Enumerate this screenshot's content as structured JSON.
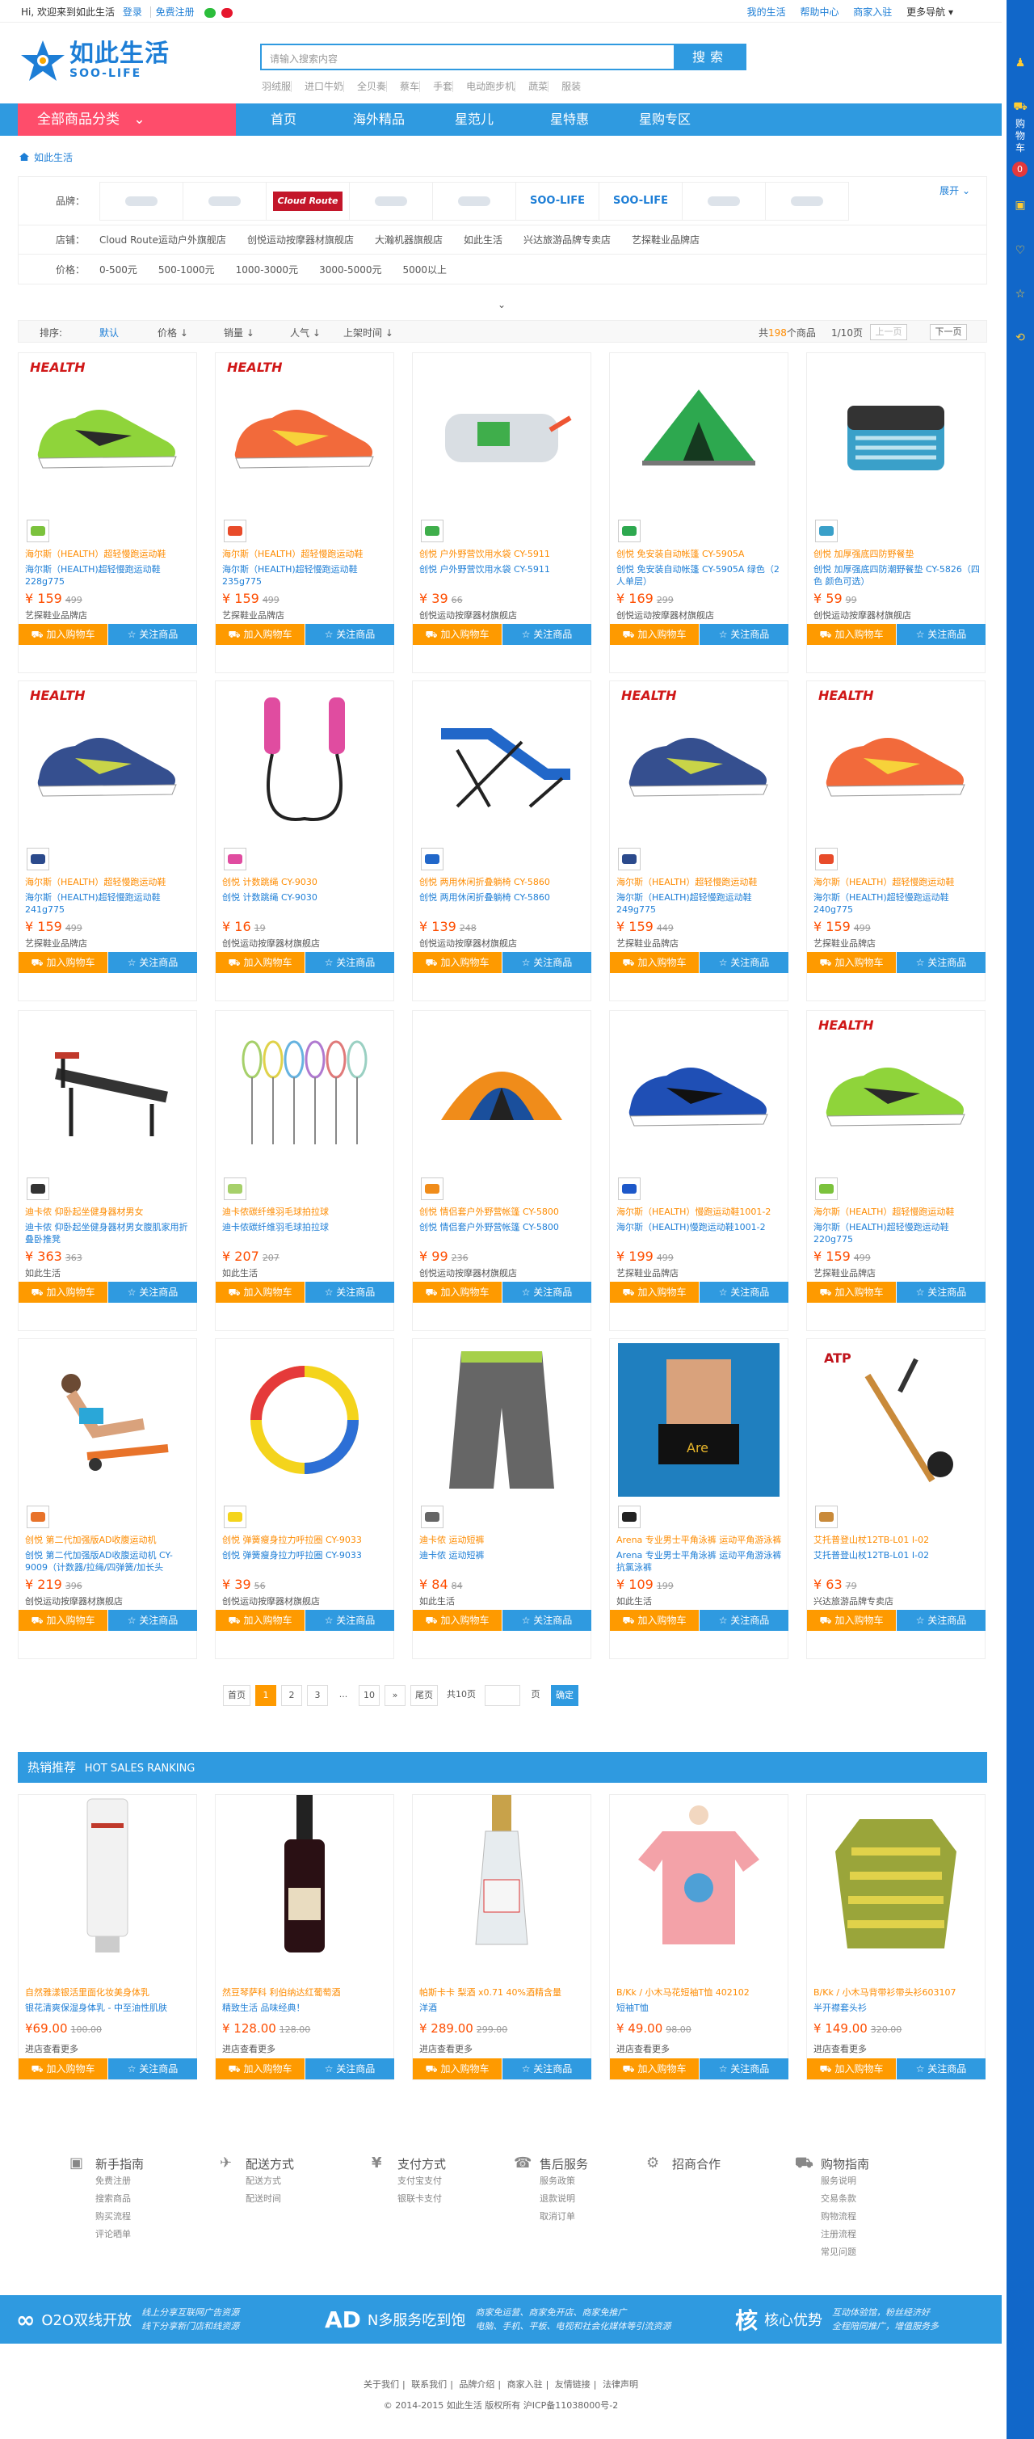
{
  "topbar": {
    "welcome": "Hi, 欢迎来到如此生活",
    "login": "登录",
    "register": "免费注册",
    "right": [
      "我的生活",
      "帮助中心",
      "商家入驻",
      "更多导航"
    ]
  },
  "logo": {
    "cn": "如此生活",
    "en": "SOO-LIFE"
  },
  "search": {
    "placeholder": "请输入搜索内容",
    "button": "搜索",
    "hotwords": [
      "羽绒服",
      "进口牛奶",
      "全贝奏",
      "蔡车",
      "手套",
      "电动跑步机",
      "蔬菜",
      "服装"
    ]
  },
  "nav": {
    "all": "全部商品分类",
    "items": [
      "首页",
      "海外精品",
      "星范儿",
      "星特惠",
      "星购专区"
    ]
  },
  "sidebar": {
    "cart": "购物车",
    "count": "0",
    "icons": [
      "cart-icon",
      "user-icon",
      "coupon-icon",
      "heart-icon",
      "star-icon",
      "refresh-icon"
    ]
  },
  "breadcrumb": "如此生活",
  "filter": {
    "brand_label": "品牌：",
    "expand": "展开",
    "brands": [
      "",
      "",
      "Cloud Route",
      "",
      "",
      "SOO-LIFE",
      "SOO-LIFE",
      "",
      ""
    ],
    "shop_label": "店铺：",
    "shops": [
      "Cloud Route运动户外旗舰店",
      "创悦运动按摩器材旗舰店",
      "大瀚机器旗舰店",
      "如此生活",
      "兴达旅游品牌专卖店",
      "艺探鞋业品牌店"
    ],
    "price_label": "价格：",
    "prices": [
      "0-500元",
      "500-1000元",
      "1000-3000元",
      "3000-5000元",
      "5000以上"
    ]
  },
  "sort": {
    "label": "排序:",
    "items": [
      "默认",
      "价格",
      "销量",
      "人气",
      "上架时间"
    ],
    "total_prefix": "共",
    "total": "198",
    "total_suffix": "个商品",
    "page": "1/10页",
    "prev": "上一页",
    "next": "下一页"
  },
  "products": [
    {
      "name": "海尔斯（HEALTH）超轻慢跑运动鞋",
      "desc": "海尔斯（HEALTH)超轻慢跑运动鞋228g775",
      "price": "¥ 159",
      "old": "499",
      "shop": "艺探鞋业品牌店",
      "color": "#7bc23c",
      "type": "shoe-green"
    },
    {
      "name": "海尔斯（HEALTH）超轻慢跑运动鞋",
      "desc": "海尔斯（HEALTH)超轻慢跑运动鞋235g775",
      "price": "¥ 159",
      "old": "499",
      "shop": "艺探鞋业品牌店",
      "color": "#e84b2a",
      "type": "shoe-red"
    },
    {
      "name": "创悦 户外野营饮用水袋 CY-5911",
      "desc": "创悦 户外野营饮用水袋 CY-5911",
      "price": "¥ 39",
      "old": "66",
      "shop": "创悦运动按摩器材旗舰店",
      "color": "#3fae4b",
      "type": "waterbag"
    },
    {
      "name": "创悦 免安装自动帐篷 CY-5905A",
      "desc": "创悦 免安装自动帐篷 CY-5905A 绿色（2人单层）",
      "price": "¥ 169",
      "old": "299",
      "shop": "创悦运动按摩器材旗舰店",
      "color": "#2da84f",
      "type": "tent-green"
    },
    {
      "name": "创悦 加厚强底四防野餐垫",
      "desc": "创悦 加厚强底四防潮野餐垫 CY-5826（四色 颜色可选）",
      "price": "¥ 59",
      "old": "99",
      "shop": "创悦运动按摩器材旗舰店",
      "color": "#3aa0c9",
      "type": "mat"
    },
    {
      "name": "海尔斯（HEALTH）超轻慢跑运动鞋",
      "desc": "海尔斯（HEALTH)超轻慢跑运动鞋241g775",
      "price": "¥ 159",
      "old": "499",
      "shop": "艺探鞋业品牌店",
      "color": "#2b4a8c",
      "type": "shoe-blue"
    },
    {
      "name": "创悦 计数跳绳 CY-9030",
      "desc": "创悦 计数跳绳 CY-9030",
      "price": "¥ 16",
      "old": "19",
      "shop": "创悦运动按摩器材旗舰店",
      "color": "#e04ca0",
      "type": "rope"
    },
    {
      "name": "创悦 两用休闲折叠躺椅 CY-5860",
      "desc": "创悦 两用休闲折叠躺椅 CY-5860",
      "price": "¥ 139",
      "old": "248",
      "shop": "创悦运动按摩器材旗舰店",
      "color": "#2167c9",
      "type": "chair"
    },
    {
      "name": "海尔斯（HEALTH）超轻慢跑运动鞋",
      "desc": "海尔斯（HEALTH)超轻慢跑运动鞋249g775",
      "price": "¥ 159",
      "old": "449",
      "shop": "艺探鞋业品牌店",
      "color": "#2b4a8c",
      "type": "shoe-blue"
    },
    {
      "name": "海尔斯（HEALTH）超轻慢跑运动鞋",
      "desc": "海尔斯（HEALTH)超轻慢跑运动鞋240g775",
      "price": "¥ 159",
      "old": "499",
      "shop": "艺探鞋业品牌店",
      "color": "#e84b2a",
      "type": "shoe-red"
    },
    {
      "name": "迪卡侬 仰卧起坐健身器材男女",
      "desc": "迪卡侬 仰卧起坐健身器材男女腹肌家用折叠卧推凳",
      "price": "¥ 363",
      "old": "363",
      "shop": "如此生活",
      "color": "#333333",
      "type": "bench"
    },
    {
      "name": "迪卡侬碳纤维羽毛球拍拉球",
      "desc": "迪卡侬碳纤维羽毛球拍拉球",
      "price": "¥ 207",
      "old": "207",
      "shop": "如此生活",
      "color": "#a6d06a",
      "type": "rackets"
    },
    {
      "name": "创悦 情侣套户外野营帐篷 CY-5800",
      "desc": "创悦 情侣套户外野营帐篷 CY-5800",
      "price": "¥ 99",
      "old": "236",
      "shop": "创悦运动按摩器材旗舰店",
      "color": "#f08c1a",
      "type": "tent-orange"
    },
    {
      "name": "海尔斯（HEALTH）慢跑运动鞋1001-2",
      "desc": "海尔斯（HEALTH)慢跑运动鞋1001-2",
      "price": "¥ 199",
      "old": "499",
      "shop": "艺探鞋业品牌店",
      "color": "#1d58c9",
      "type": "shoe-navy"
    },
    {
      "name": "海尔斯（HEALTH）超轻慢跑运动鞋",
      "desc": "海尔斯（HEALTH)超轻慢跑运动鞋220g775",
      "price": "¥ 159",
      "old": "499",
      "shop": "艺探鞋业品牌店",
      "color": "#7bc23c",
      "type": "shoe-green"
    },
    {
      "name": "创悦 第二代加强版AD收腹运动机",
      "desc": "创悦 第二代加强版AD收腹运动机 CY-9009（计数器/拉绳/四弹簧/加长头",
      "price": "¥ 219",
      "old": "396",
      "shop": "创悦运动按摩器材旗舰店",
      "color": "#e8732a",
      "type": "woman"
    },
    {
      "name": "创悦 弹簧瘦身拉力呼拉圈 CY-9033",
      "desc": "创悦 弹簧瘦身拉力呼拉圈 CY-9033",
      "price": "¥ 39",
      "old": "56",
      "shop": "创悦运动按摩器材旗舰店",
      "color": "#f4d41c",
      "type": "hoop"
    },
    {
      "name": "迪卡侬 运动短裤",
      "desc": "迪卡侬 运动短裤",
      "price": "¥ 84",
      "old": "84",
      "shop": "如此生活",
      "color": "#666666",
      "type": "shorts"
    },
    {
      "name": "Arena 专业男士平角泳裤 运动平角游泳裤",
      "desc": "Arena 专业男士平角泳裤 运动平角游泳裤抗氯泳裤",
      "price": "¥ 109",
      "old": "199",
      "shop": "如此生活",
      "color": "#222222",
      "type": "swim"
    },
    {
      "name": "艾托普登山杖12TB-L01 I-02",
      "desc": "艾托普登山杖12TB-L01 I-02",
      "price": "¥ 63",
      "old": "79",
      "shop": "兴达旅游品牌专卖店",
      "color": "#c98a3a",
      "type": "pole"
    }
  ],
  "pager": {
    "items": [
      "首页",
      "1",
      "2",
      "3",
      "...",
      "10",
      "»",
      "尾页"
    ],
    "total": "共10页",
    "goto": "页",
    "ok": "确定"
  },
  "hot": {
    "title": "热销推荐",
    "en": "HOT SALES RANKING"
  },
  "hot_products": [
    {
      "name": "自然雅漾银活里面化妆美身体乳",
      "desc": "银花清爽保湿身体乳 - 中至油性肌肤",
      "price": "¥69.00",
      "old": "100.00",
      "shop": "进店查看更多",
      "type": "tube"
    },
    {
      "name": "然豆琴萨科 利伯纳达红葡萄酒",
      "desc": "精致生活 品味经典！",
      "price": "¥ 128.00",
      "old": "128.00",
      "shop": "进店查看更多",
      "type": "wine"
    },
    {
      "name": "帕斯卡卡 梨酒 x0.71 40%酒精含量",
      "desc": "洋酒",
      "price": "¥ 289.00",
      "old": "299.00",
      "shop": "进店查看更多",
      "type": "bottle"
    },
    {
      "name": "B/Kk / 小木马花短袖T恤 402102",
      "desc": "短袖T恤",
      "price": "¥ 49.00",
      "old": "98.00",
      "shop": "进店查看更多",
      "type": "tshirt"
    },
    {
      "name": "B/Kk / 小木马背带衫带头衫603107",
      "desc": "半开襟套头衫",
      "price": "¥ 149.00",
      "old": "320.00",
      "shop": "进店查看更多",
      "type": "hoodie"
    }
  ],
  "btn": {
    "cart": "加入购物车",
    "follow": "关注商品"
  },
  "footer": {
    "cols": [
      {
        "h": "新手指南",
        "items": [
          "免费注册",
          "搜索商品",
          "购买流程",
          "评论晒单"
        ],
        "icon": "bag-icon"
      },
      {
        "h": "配送方式",
        "items": [
          "配送方式",
          "配送时间"
        ],
        "icon": "plane-icon"
      },
      {
        "h": "支付方式",
        "items": [
          "支付宝支付",
          "银联卡支付"
        ],
        "icon": "money-icon"
      },
      {
        "h": "售后服务",
        "items": [
          "服务政策",
          "退款说明",
          "取消订单"
        ],
        "icon": "service-icon"
      },
      {
        "h": "招商合作",
        "items": [],
        "icon": "gear-icon"
      },
      {
        "h": "购物指南",
        "items": [
          "服务说明",
          "交易条款",
          "购物流程",
          "注册流程",
          "常见问题"
        ],
        "icon": "cart-guide-icon"
      }
    ],
    "band": [
      {
        "ico": "O2O",
        "title": "O2O双线开放",
        "sub": "线上分享互联网广告资源\n线下分享新门店和线资源"
      },
      {
        "ico": "AD",
        "title": "N多服务吃到饱",
        "sub": "商家免运营、商家免开店、商家免推广\n电脑、手机、平板、电视和社会化媒体等引流资源"
      },
      {
        "ico": "核",
        "title": "核心优势",
        "sub": "互动体验馆，粉丝经济好\n全程陪同推广，增值服务多"
      }
    ],
    "links": [
      "关于我们",
      "联系我们",
      "品牌介绍",
      "商家入驻",
      "友情链接",
      "法律声明"
    ],
    "copyright": "© 2014-2015 如此生活 版权所有 沪ICP备11038000号-2"
  }
}
